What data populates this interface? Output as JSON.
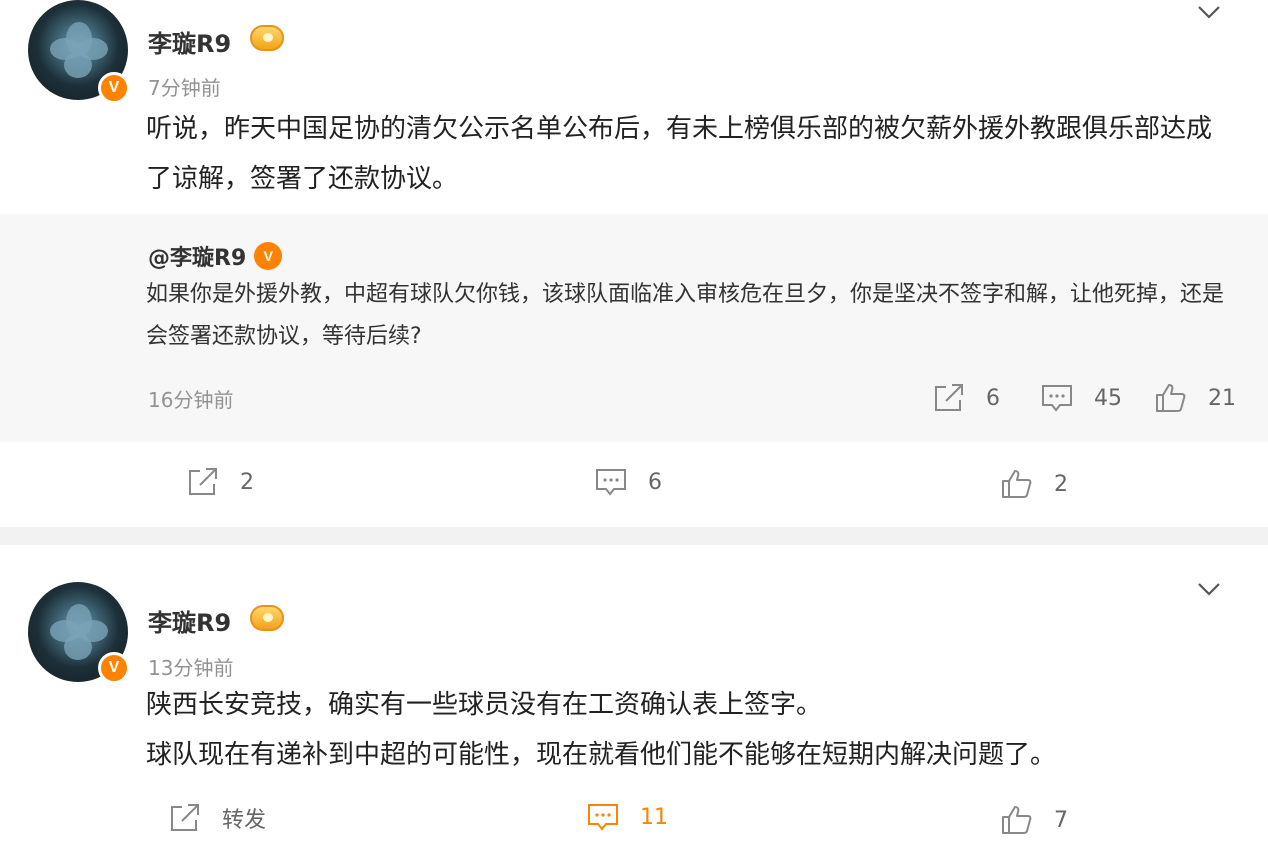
{
  "posts": [
    {
      "username": "李璇R9",
      "time": "7分钟前",
      "content": "听说，昨天中国足协的清欠公示名单公布后，有未上榜俱乐部的被欠薪外援外教跟俱乐部达成了谅解，签署了还款协议。",
      "quote": {
        "username": "@李璇R9",
        "text": "如果你是外援外教，中超有球队欠你钱，该球队面临准入审核危在旦夕，你是坚决不签字和解，让他死掉，还是会签署还款协议，等待后续?",
        "time": "16分钟前",
        "reposts": "6",
        "comments": "45",
        "likes": "21"
      },
      "reposts": "2",
      "comments": "6",
      "likes": "2"
    },
    {
      "username": "李璇R9",
      "time": "13分钟前",
      "content_lines": [
        "陕西长安竞技，确实有一些球员没有在工资确认表上签字。",
        "球队现在有递补到中超的可能性，现在就看他们能不能够在短期内解决问题了。"
      ],
      "repost_label": "转发",
      "comments": "11",
      "likes": "7"
    }
  ],
  "colors": {
    "accent": "#ff8200",
    "muted": "#939393",
    "quote_bg": "#f7f7f7",
    "separator": "#f2f2f2"
  },
  "icons": {
    "verified": "V",
    "repost": "share-icon",
    "comment": "comment-icon",
    "like": "thumbs-up-icon",
    "menu": "chevron-down-icon",
    "level": "level-badge-icon"
  }
}
